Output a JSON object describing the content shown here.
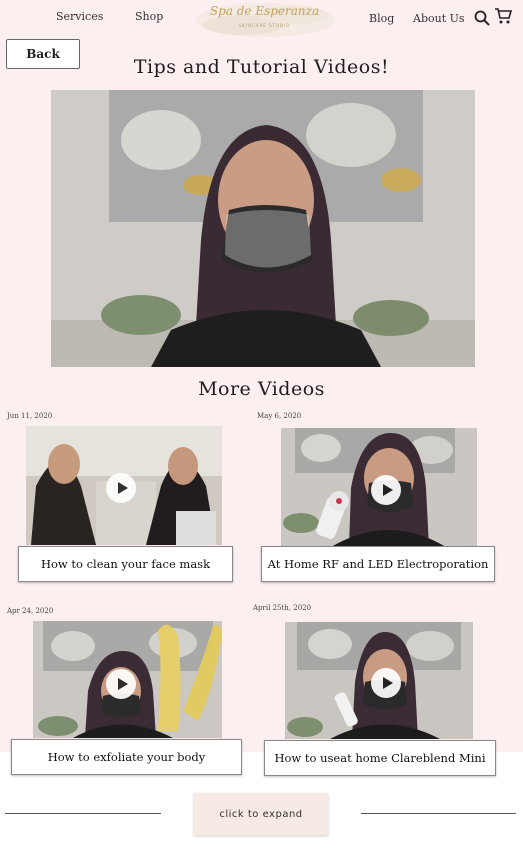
{
  "nav": {
    "services": "Services",
    "shop": "Shop",
    "blog": "Blog",
    "about": "About Us",
    "logo_text": "Spa de Esperanza",
    "logo_subtext": "SKINCARE STUDIO"
  },
  "back_label": "Back",
  "page_title": "Tips and Tutorial Videos!",
  "more_title": "More Videos",
  "videos": [
    {
      "date": "Jun 11, 2020",
      "title": "How to clean your face mask"
    },
    {
      "date": "May 6, 2020",
      "title": "At Home RF and LED Electroporation"
    },
    {
      "date": "Apr 24, 2020",
      "title": "How to exfoliate your body"
    },
    {
      "date": "April 25th, 2020",
      "title": "How to useat home Clareblend Mini"
    }
  ],
  "expand_label": "click to expand",
  "colors": {
    "page_bg": "#fbeff0",
    "expand_bg": "#f7e9e4"
  },
  "icons": [
    "search-icon",
    "cart-icon",
    "play-icon"
  ]
}
